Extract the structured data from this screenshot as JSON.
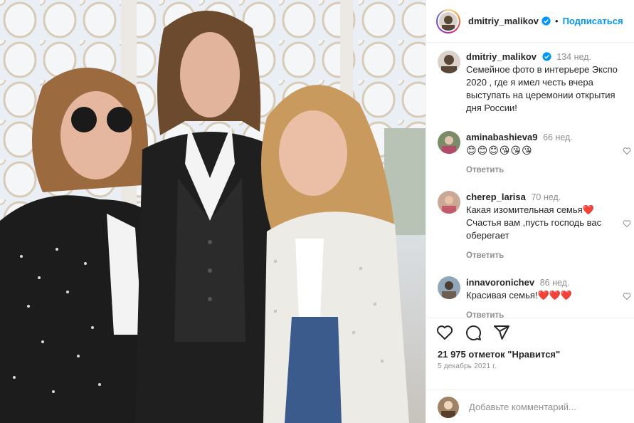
{
  "post": {
    "username": "dmitriy_malikov",
    "follow_label": "Подписаться",
    "caption_time": "134 нед.",
    "caption_text": "Семейное фото в интерьере Экспо 2020 , где я имел честь вчера выступать на церемонии открытия дня России!",
    "likes": "21 975 отметок \"Нравится\"",
    "date": "5 декабрь 2021 г.",
    "add_comment_placeholder": "Добавьте комментарий..."
  },
  "comments": [
    {
      "username": "aminabashieva9",
      "time": "66 нед.",
      "text": "😊😊😊😘😘😘",
      "reply": "Ответить"
    },
    {
      "username": "cherep_larisa",
      "time": "70 нед.",
      "text": "Какая изомительная семья❤️ Счастья вам ,пусть господь вас оберегает",
      "reply": "Ответить"
    },
    {
      "username": "innavoronichev",
      "time": "86 нед.",
      "text": "Красивая семья!❤️❤️❤️",
      "reply": "Ответить"
    }
  ],
  "icons": [
    "heart-icon",
    "comment-icon",
    "share-icon",
    "verified-badge-icon"
  ],
  "colors": {
    "accent": "#0095f6",
    "muted": "#8e8e8e",
    "text": "#262626"
  }
}
